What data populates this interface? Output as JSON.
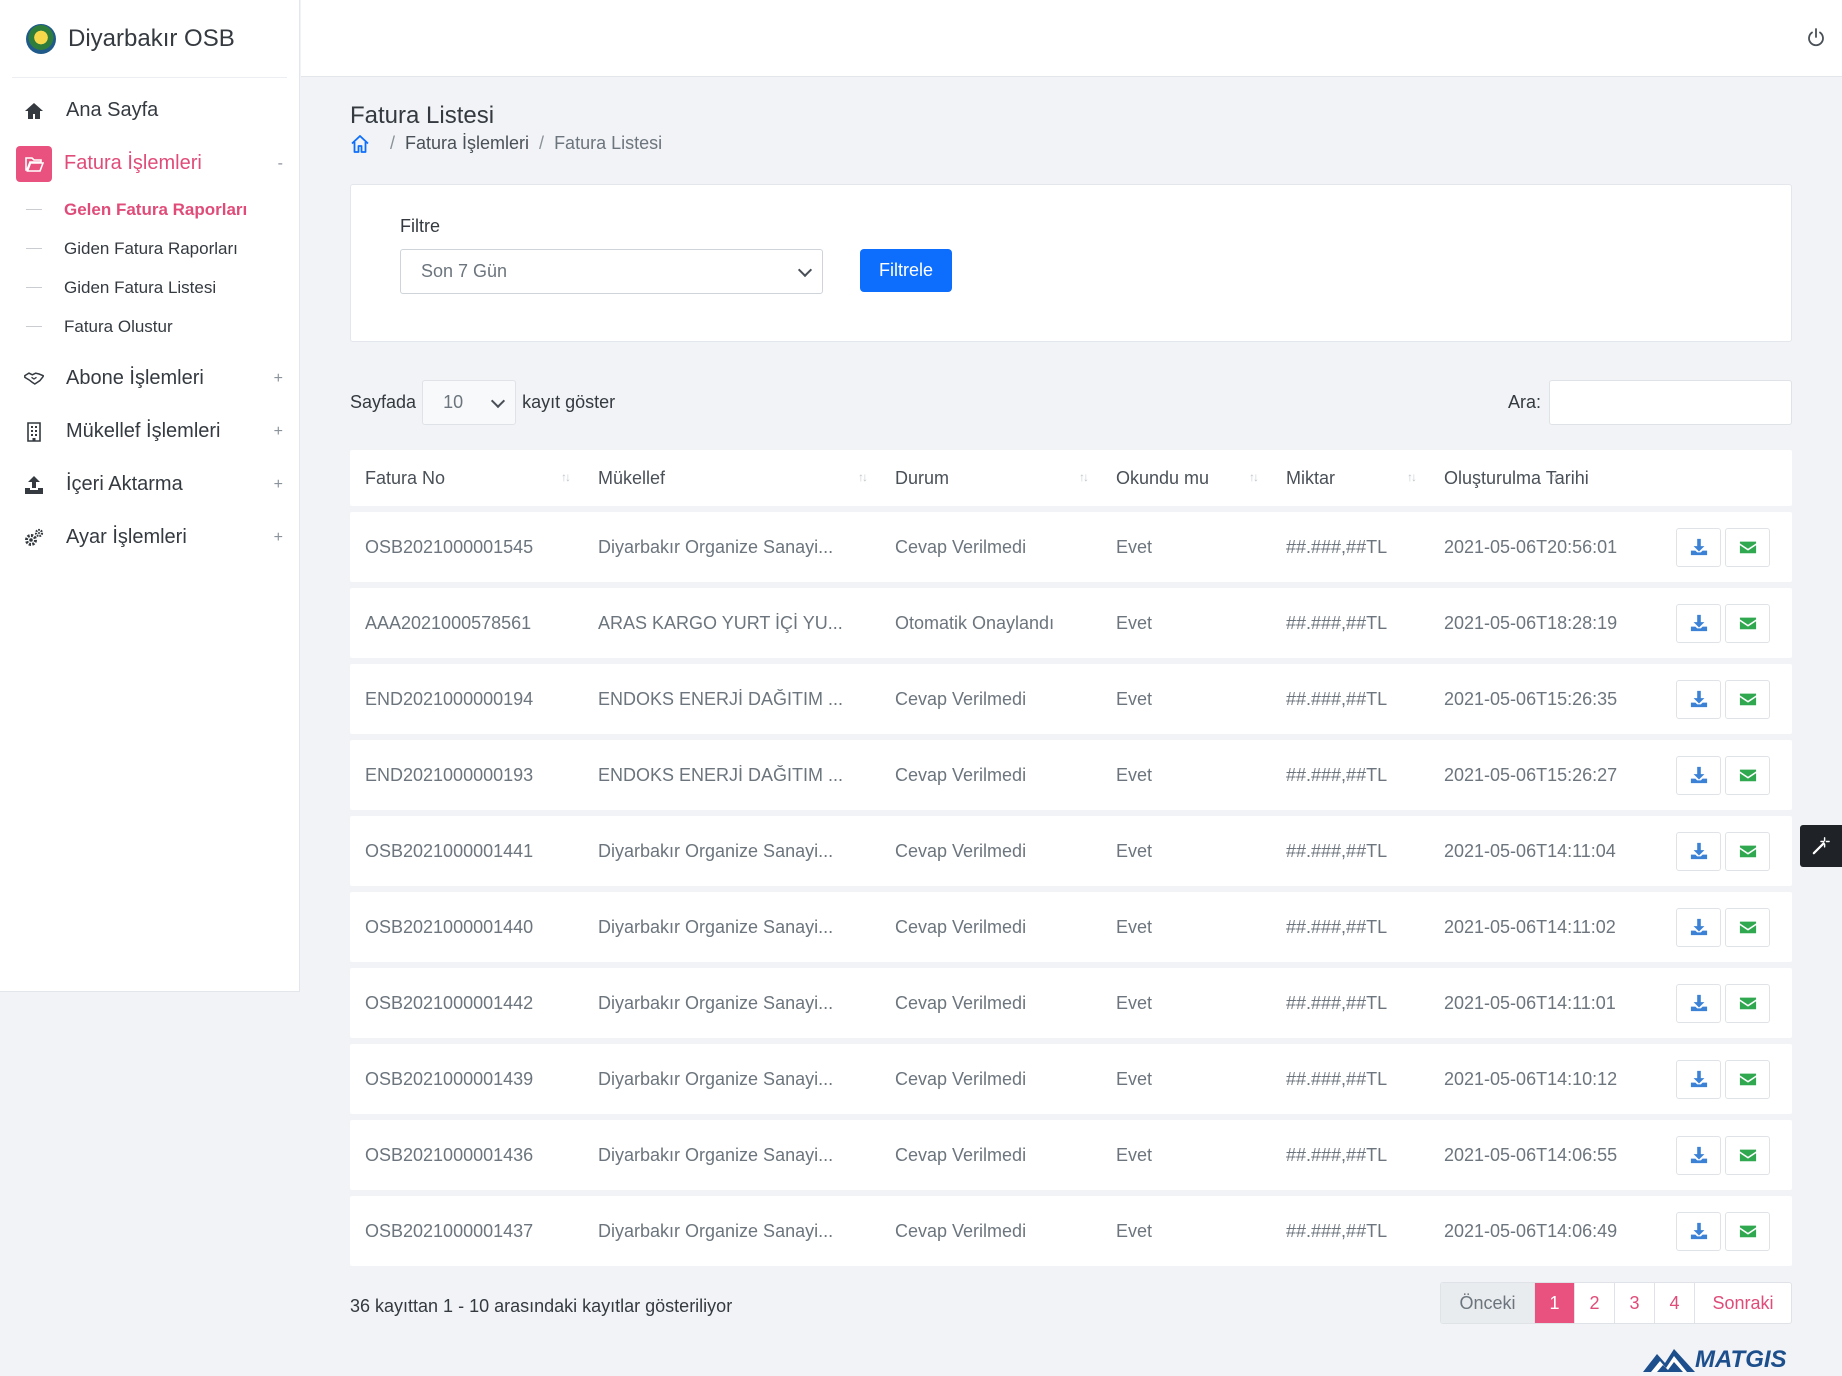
{
  "brand": {
    "name": "Diyarbakır OSB"
  },
  "nav": {
    "home": "Ana Sayfa",
    "fatura": {
      "label": "Fatura İşlemleri",
      "toggle": "-"
    },
    "submenu": [
      "Gelen Fatura Raporları",
      "Giden Fatura Raporları",
      "Giden Fatura Listesi",
      "Fatura Olustur"
    ],
    "abone": {
      "label": "Abone İşlemleri",
      "toggle": "+"
    },
    "mukellef": {
      "label": "Mükellef İşlemleri",
      "toggle": "+"
    },
    "iceri": {
      "label": "İçeri Aktarma",
      "toggle": "+"
    },
    "ayar": {
      "label": "Ayar İşlemleri",
      "toggle": "+"
    }
  },
  "page": {
    "title": "Fatura Listesi",
    "breadcrumb": [
      "Fatura İşlemleri",
      "Fatura Listesi"
    ]
  },
  "filter": {
    "label": "Filtre",
    "selected": "Son 7 Gün",
    "button": "Filtrele"
  },
  "length": {
    "prefix": "Sayfada",
    "value": "10",
    "suffix": "kayıt göster"
  },
  "search": {
    "label": "Ara:"
  },
  "table": {
    "columns": [
      "Fatura No",
      "Mükellef",
      "Durum",
      "Okundu mu",
      "Miktar",
      "Oluşturulma Tarihi"
    ],
    "rows": [
      [
        "OSB2021000001545",
        "Diyarbakır Organize Sanayi...",
        "Cevap Verilmedi",
        "Evet",
        "##.###,##TL",
        "2021-05-06T20:56:01"
      ],
      [
        "AAA2021000578561",
        "ARAS KARGO YURT İÇİ YU...",
        "Otomatik Onaylandı",
        "Evet",
        "##.###,##TL",
        "2021-05-06T18:28:19"
      ],
      [
        "END2021000000194",
        "ENDOKS ENERJİ DAĞITIM ...",
        "Cevap Verilmedi",
        "Evet",
        "##.###,##TL",
        "2021-05-06T15:26:35"
      ],
      [
        "END2021000000193",
        "ENDOKS ENERJİ DAĞITIM ...",
        "Cevap Verilmedi",
        "Evet",
        "##.###,##TL",
        "2021-05-06T15:26:27"
      ],
      [
        "OSB2021000001441",
        "Diyarbakır Organize Sanayi...",
        "Cevap Verilmedi",
        "Evet",
        "##.###,##TL",
        "2021-05-06T14:11:04"
      ],
      [
        "OSB2021000001440",
        "Diyarbakır Organize Sanayi...",
        "Cevap Verilmedi",
        "Evet",
        "##.###,##TL",
        "2021-05-06T14:11:02"
      ],
      [
        "OSB2021000001442",
        "Diyarbakır Organize Sanayi...",
        "Cevap Verilmedi",
        "Evet",
        "##.###,##TL",
        "2021-05-06T14:11:01"
      ],
      [
        "OSB2021000001439",
        "Diyarbakır Organize Sanayi...",
        "Cevap Verilmedi",
        "Evet",
        "##.###,##TL",
        "2021-05-06T14:10:12"
      ],
      [
        "OSB2021000001436",
        "Diyarbakır Organize Sanayi...",
        "Cevap Verilmedi",
        "Evet",
        "##.###,##TL",
        "2021-05-06T14:06:55"
      ],
      [
        "OSB2021000001437",
        "Diyarbakır Organize Sanayi...",
        "Cevap Verilmedi",
        "Evet",
        "##.###,##TL",
        "2021-05-06T14:06:49"
      ]
    ]
  },
  "info": "36 kayıttan 1 - 10 arasındaki kayıtlar gösteriliyor",
  "pagination": {
    "prev": "Önceki",
    "pages": [
      "1",
      "2",
      "3",
      "4"
    ],
    "current": "1",
    "next": "Sonraki"
  },
  "footer": {
    "logo_text": "MATGIS"
  },
  "colors": {
    "accent": "#e9527f",
    "primary": "#0d6efd",
    "download": "#3b82d6",
    "email": "#2fa84f"
  }
}
